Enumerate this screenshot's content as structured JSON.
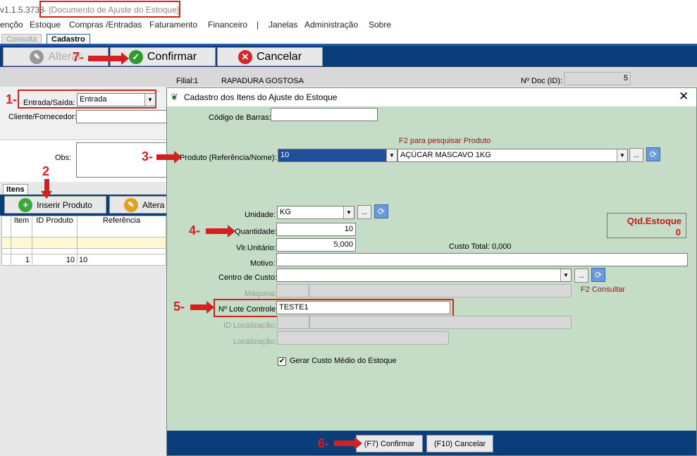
{
  "window": {
    "version": "v1.1.5.3738",
    "title": "- [Documento de Ajuste do Estoque]"
  },
  "menu": [
    "ençõo",
    "Estoque",
    "Compras /Entradas",
    "Faturamento",
    "Financeiro",
    "|",
    "Janelas",
    "Administração",
    "Sobre"
  ],
  "tabs": {
    "consulta": "Consulta",
    "cadastro": "Cadastro"
  },
  "toolbar": {
    "alterar": "Alterar",
    "confirmar": "Confirmar",
    "cancelar": "Cancelar"
  },
  "form": {
    "filial_label": "Filial:",
    "filial_num": "1",
    "filial_name": "RAPADURA GOSTOSA",
    "ndoc_label": "Nº Doc (ID):",
    "ndoc_value": "5",
    "entrada_label": "Entrada/Saída:",
    "entrada_value": "Entrada",
    "cliente_label": "Cliente/Fornecedor:",
    "obs_label": "Obs:"
  },
  "itens": {
    "tab": "Itens",
    "inserir": "Inserir Produto",
    "alterar": "Altera",
    "columns": [
      "Item",
      "ID Produto",
      "Referência"
    ],
    "rows": [
      {
        "item": "1",
        "id": "10",
        "ref": "10"
      }
    ]
  },
  "dialog": {
    "title": "Cadastro dos Itens do Ajuste do Estoque",
    "codigo_barras_label": "Código de Barras:",
    "f2_hint": "F2 para pesquisar Produto",
    "produto_label": "Produto (Referência/Nome):",
    "produto_ref": "10",
    "produto_nome": "AÇÚCAR MASCAVO 1KG",
    "unidade_label": "Unidade:",
    "unidade_value": "KG",
    "quantidade_label": "Quantidade:",
    "quantidade_value": "10",
    "vlr_label": "Vlr.Unitário:",
    "vlr_value": "5,000",
    "custo_total": "Custo Total: 0,000",
    "qtd_estoque_label": "Qtd.Estoque",
    "qtd_estoque_value": "0",
    "motivo_label": "Motivo:",
    "centro_label": "Centro de Custo:",
    "maquina_label": "Máquina:",
    "f2_consultar": "F2 Consultar",
    "lote_label": "Nº Lote Controle:",
    "lote_value": "TESTE1",
    "id_local_label": "ID Localização:",
    "local_label": "Localização:",
    "gerar_label": "Gerar Custo Médio do Estoque",
    "confirmar_btn": "(F7) Confirmar",
    "cancelar_btn": "(F10) Cancelar"
  },
  "annotations": [
    "1-",
    "2",
    "3-",
    "4-",
    "5-",
    "6-",
    "7-"
  ],
  "colors": {
    "toolbar": "#0b3d7a",
    "dialog_bg": "#c5dcc6",
    "annotation": "#d42020"
  }
}
